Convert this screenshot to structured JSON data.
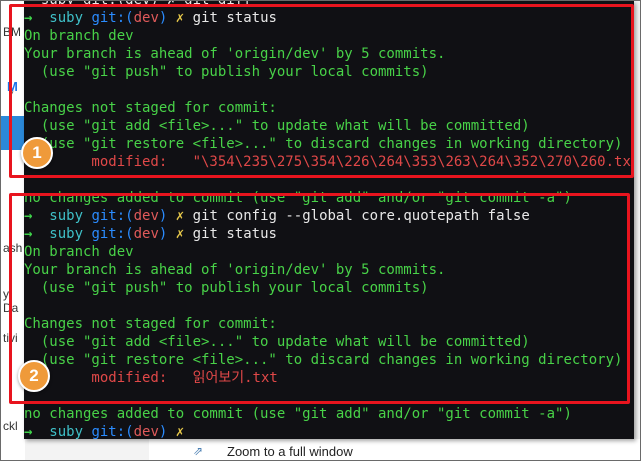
{
  "background": {
    "left_labels": [
      "BM",
      "ash",
      "y Da",
      "tivi",
      "ckl"
    ],
    "link_text": "Zoom to a full window"
  },
  "terminal": {
    "top_partial": "- suby git:(dev) ✗ git diff",
    "lines": [
      {
        "parts": [
          {
            "t": "→  ",
            "c": "c-arrow"
          },
          {
            "t": "suby ",
            "c": "c-user"
          },
          {
            "t": "git:(",
            "c": "c-git"
          },
          {
            "t": "dev",
            "c": "c-br"
          },
          {
            "t": ")",
            "c": "c-git"
          },
          {
            "t": " ✗ ",
            "c": "c-x"
          },
          {
            "t": "git status",
            "c": "c-cmd"
          }
        ]
      },
      {
        "parts": [
          {
            "t": "On branch dev",
            "c": "c-green"
          }
        ]
      },
      {
        "parts": [
          {
            "t": "Your branch is ahead of 'origin/dev' by 5 commits.",
            "c": "c-green"
          }
        ]
      },
      {
        "parts": [
          {
            "t": "  (use \"git push\" to publish your local commits)",
            "c": "c-green"
          }
        ]
      },
      {
        "parts": [
          {
            "t": "",
            "c": "c-green"
          }
        ]
      },
      {
        "parts": [
          {
            "t": "Changes not staged for commit:",
            "c": "c-green"
          }
        ]
      },
      {
        "parts": [
          {
            "t": "  (use \"git add <file>...\" to update what will be committed)",
            "c": "c-green"
          }
        ]
      },
      {
        "parts": [
          {
            "t": "  (use \"git restore <file>...\" to discard changes in working directory)",
            "c": "c-green"
          }
        ]
      },
      {
        "parts": [
          {
            "t": "        modified:   ",
            "c": "c-red"
          },
          {
            "t": "\"\\354\\235\\275\\354\\226\\264\\353\\263\\264\\352\\270\\260.txt\"",
            "c": "c-red"
          }
        ]
      },
      {
        "parts": [
          {
            "t": "",
            "c": "c-green"
          }
        ]
      },
      {
        "parts": [
          {
            "t": "no changes added to commit (use \"git add\" and/or \"git commit -a\")",
            "c": "c-green"
          }
        ]
      },
      {
        "parts": [
          {
            "t": "→  ",
            "c": "c-arrow"
          },
          {
            "t": "suby ",
            "c": "c-user"
          },
          {
            "t": "git:(",
            "c": "c-git"
          },
          {
            "t": "dev",
            "c": "c-br"
          },
          {
            "t": ")",
            "c": "c-git"
          },
          {
            "t": " ✗ ",
            "c": "c-x"
          },
          {
            "t": "git config --global core.quotepath false",
            "c": "c-cmd"
          }
        ]
      },
      {
        "parts": [
          {
            "t": "→  ",
            "c": "c-arrow"
          },
          {
            "t": "suby ",
            "c": "c-user"
          },
          {
            "t": "git:(",
            "c": "c-git"
          },
          {
            "t": "dev",
            "c": "c-br"
          },
          {
            "t": ")",
            "c": "c-git"
          },
          {
            "t": " ✗ ",
            "c": "c-x"
          },
          {
            "t": "git status",
            "c": "c-cmd"
          }
        ]
      },
      {
        "parts": [
          {
            "t": "On branch dev",
            "c": "c-green"
          }
        ]
      },
      {
        "parts": [
          {
            "t": "Your branch is ahead of 'origin/dev' by 5 commits.",
            "c": "c-green"
          }
        ]
      },
      {
        "parts": [
          {
            "t": "  (use \"git push\" to publish your local commits)",
            "c": "c-green"
          }
        ]
      },
      {
        "parts": [
          {
            "t": "",
            "c": "c-green"
          }
        ]
      },
      {
        "parts": [
          {
            "t": "Changes not staged for commit:",
            "c": "c-green"
          }
        ]
      },
      {
        "parts": [
          {
            "t": "  (use \"git add <file>...\" to update what will be committed)",
            "c": "c-green"
          }
        ]
      },
      {
        "parts": [
          {
            "t": "  (use \"git restore <file>...\" to discard changes in working directory)",
            "c": "c-green"
          }
        ]
      },
      {
        "parts": [
          {
            "t": "        modified:   ",
            "c": "c-red"
          },
          {
            "t": "읽어보기.txt",
            "c": "c-red"
          }
        ]
      },
      {
        "parts": [
          {
            "t": "",
            "c": "c-green"
          }
        ]
      },
      {
        "parts": [
          {
            "t": "no changes added to commit (use \"git add\" and/or \"git commit -a\")",
            "c": "c-green"
          }
        ]
      },
      {
        "parts": [
          {
            "t": "→  ",
            "c": "c-arrow"
          },
          {
            "t": "suby ",
            "c": "c-user"
          },
          {
            "t": "git:(",
            "c": "c-git"
          },
          {
            "t": "dev",
            "c": "c-br"
          },
          {
            "t": ")",
            "c": "c-git"
          },
          {
            "t": " ✗",
            "c": "c-x"
          }
        ]
      }
    ]
  },
  "annotations": {
    "badge1": "1",
    "badge2": "2",
    "box_color": "#e8141e",
    "badge_color": "#ef9a3a"
  }
}
